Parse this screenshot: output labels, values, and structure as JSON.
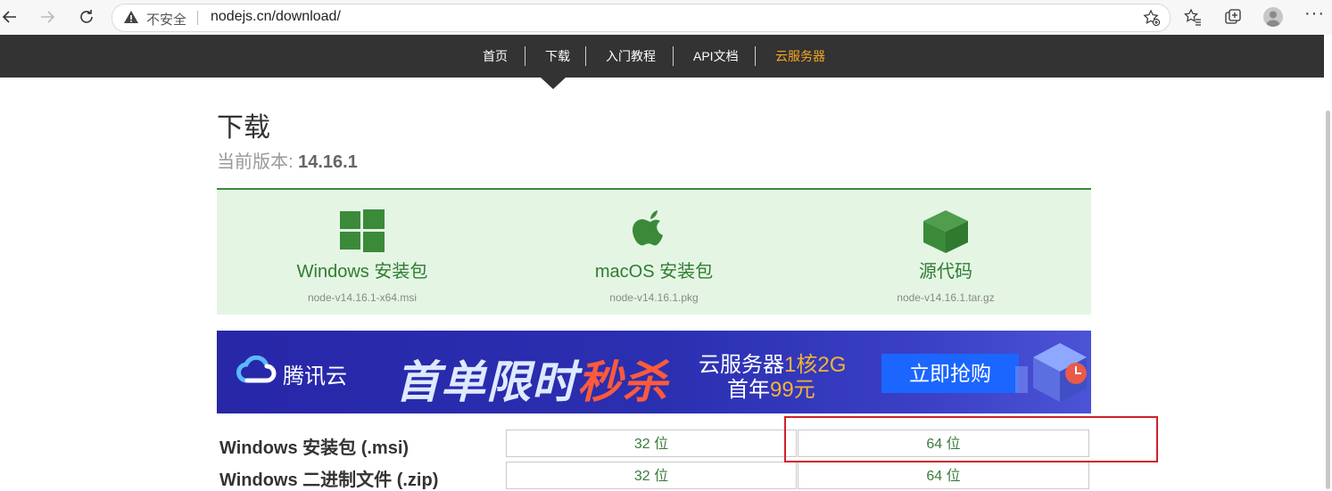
{
  "browser": {
    "insecure_label": "不安全",
    "url": "nodejs.cn/download/"
  },
  "site_nav": {
    "items": [
      "首页",
      "下载",
      "入门教程",
      "API文档",
      "云服务器"
    ]
  },
  "page": {
    "title": "下载",
    "version_label": "当前版本: ",
    "version": "14.16.1"
  },
  "downloads": [
    {
      "title": "Windows 安装包",
      "file": "node-v14.16.1-x64.msi",
      "icon": "windows-logo"
    },
    {
      "title": "macOS 安装包",
      "file": "node-v14.16.1.pkg",
      "icon": "apple-logo"
    },
    {
      "title": "源代码",
      "file": "node-v14.16.1.tar.gz",
      "icon": "box-icon"
    }
  ],
  "banner": {
    "brand": "腾讯云",
    "promo_main": "首单限时",
    "promo_red": "秒杀",
    "offer_line1": "云服务器",
    "offer_line1_hl": "1核2G",
    "offer_line2": "首年",
    "offer_line2_hl": "99元",
    "button": "立即抢购"
  },
  "table": {
    "rows": [
      {
        "label": "Windows 安装包 (.msi)",
        "col32": "32 位",
        "col64": "64 位"
      },
      {
        "label": "Windows 二进制文件 (.zip)",
        "col32": "32 位",
        "col64": "64 位"
      }
    ]
  },
  "colors": {
    "nav_bg": "#333333",
    "accent_green": "#3b8a3a",
    "download_bg": "#e5f5e4",
    "highlight_box": "#d32029",
    "cloud_nav": "#f5a623"
  }
}
